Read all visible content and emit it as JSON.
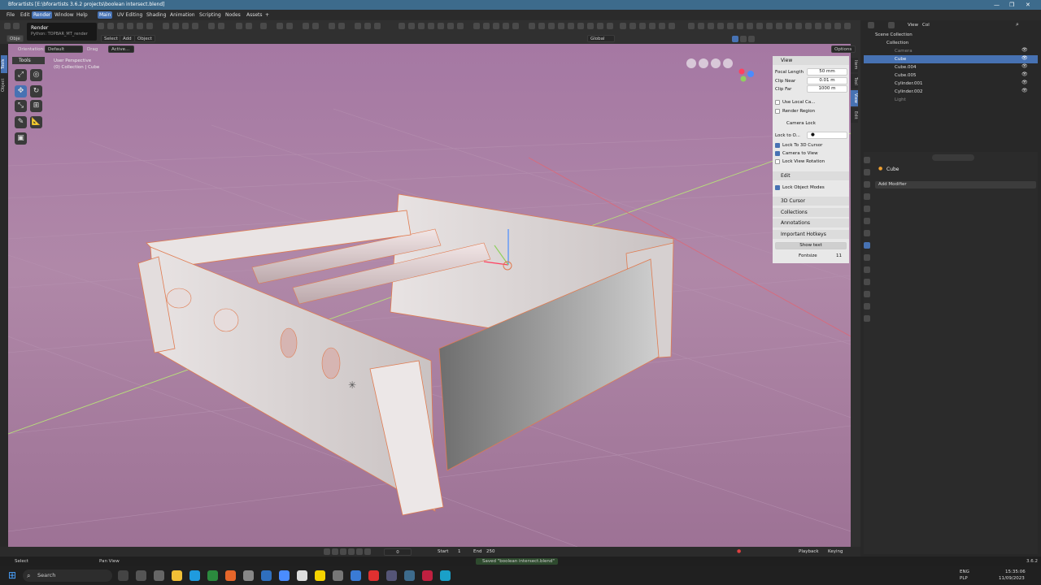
{
  "window": {
    "title": "Bforartists [E:\\bforartists 3.6.2 projects\\boolean intersect.blend]"
  },
  "menubar": {
    "menus": [
      "File",
      "Edit",
      "Render",
      "Window",
      "Help"
    ],
    "active_menu": "Render",
    "workspaces": [
      "Main",
      "UV Editing",
      "Shading",
      "Animation",
      "Scripting",
      "Nodes",
      "Assets"
    ],
    "active_workspace": "Main",
    "add_workspace": "+"
  },
  "tooltip": {
    "title": "Render",
    "python": "Python: TOPBAR_MT_render"
  },
  "header": {
    "mode": "Obje",
    "select": "Select",
    "add": "Add",
    "object": "Object",
    "transform_orientation": "Global",
    "orientation_label": "Orientation:",
    "orientation_value": "Default",
    "drag_label": "Drag",
    "drag_value": "Active...",
    "options": "Options"
  },
  "viewport": {
    "left_tabs": [
      "Tools",
      "Object"
    ],
    "tools_title": "Tools",
    "view_name": "User Perspective",
    "collection_info": "(0) Collection | Cube"
  },
  "npanel": {
    "tabs": [
      "Item",
      "Tool",
      "View",
      "Edit"
    ],
    "active_tab": "View",
    "view_header": "View",
    "focal_length_label": "Focal Length",
    "focal_length_value": "50 mm",
    "clip_near_label": "Clip Near",
    "clip_near_value": "0.01 m",
    "clip_far_label": "Clip Far",
    "clip_far_value": "1000 m",
    "use_local_camera": "Use Local Ca...",
    "render_region": "Render Region",
    "camera_lock": "Camera Lock",
    "lock_to_object": "Lock to O...",
    "lock_to_3d_cursor": "Lock To 3D Cursor",
    "camera_to_view": "Camera to View",
    "lock_view_rotation": "Lock View Rotation",
    "edit_header": "Edit",
    "lock_object_modes": "Lock Object Modes",
    "cursor_header": "3D Cursor",
    "collections_header": "Collections",
    "annotations_header": "Annotations",
    "hotkeys_header": "Important Hotkeys",
    "show_text": "Show text",
    "fontsize_label": "Fontsize",
    "fontsize_value": "11"
  },
  "outliner": {
    "header_view": "View",
    "header_col": "Col",
    "items": [
      {
        "label": "Scene Collection"
      },
      {
        "label": "Collection"
      },
      {
        "label": "Camera"
      },
      {
        "label": "Cube"
      },
      {
        "label": "Cube.004"
      },
      {
        "label": "Cube.005"
      },
      {
        "label": "Cylinder.001"
      },
      {
        "label": "Cylinder.002"
      },
      {
        "label": "Light"
      }
    ],
    "selected": "Cube"
  },
  "properties": {
    "object_name": "Cube",
    "add_modifier": "Add Modifier"
  },
  "timeline": {
    "current_frame": "0",
    "start_label": "Start",
    "start_value": "1",
    "end_label": "End",
    "end_value": "250",
    "playback": "Playback",
    "keying": "Keying"
  },
  "statusbar": {
    "left": "Select",
    "middle": "Pan View",
    "message": "Saved \"boolean intersect.blend\"",
    "version": "3.6.2"
  },
  "taskbar": {
    "search_placeholder": "Search",
    "lang": "ENG",
    "layout": "PLP",
    "time": "15:35:06",
    "date": "11/09/2023"
  },
  "colors": {
    "accent": "#4772b3",
    "titlebar": "#3d6b8c",
    "viewport_bg": "#a578a3"
  }
}
